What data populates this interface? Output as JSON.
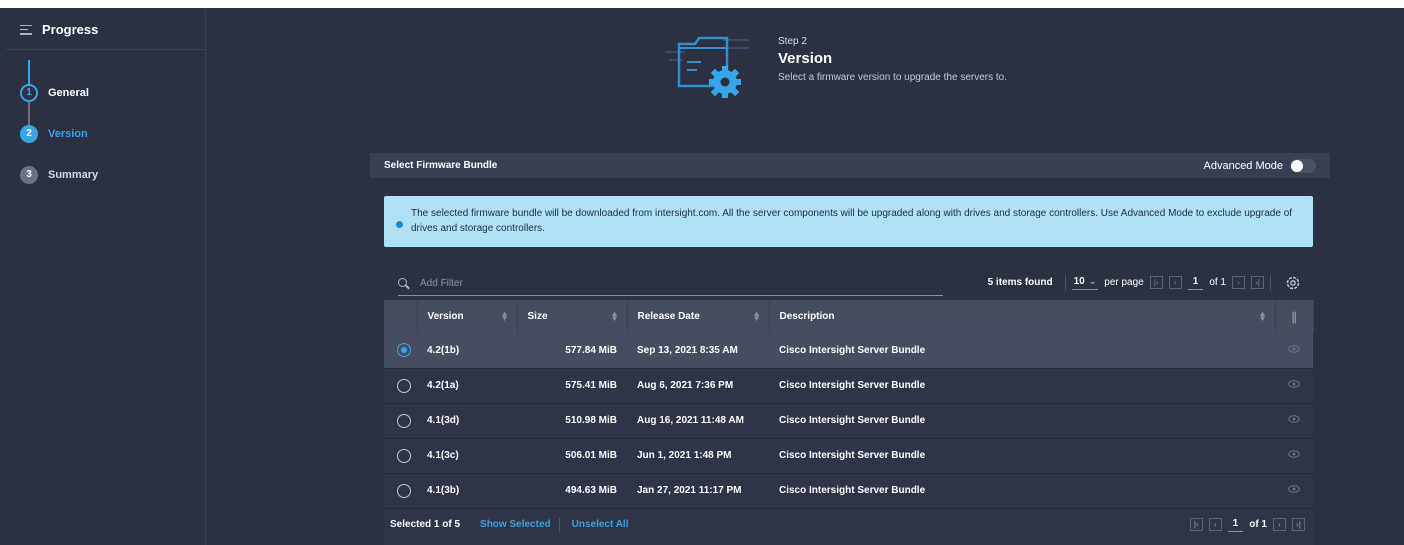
{
  "sidebar": {
    "title": "Progress",
    "steps": [
      {
        "num": "1",
        "label": "General",
        "state": "done"
      },
      {
        "num": "2",
        "label": "Version",
        "state": "active"
      },
      {
        "num": "3",
        "label": "Summary",
        "state": "todo"
      }
    ]
  },
  "header": {
    "step_label": "Step 2",
    "title": "Version",
    "subtitle": "Select a firmware version to upgrade the servers to."
  },
  "bundle": {
    "label": "Select Firmware Bundle",
    "advanced_mode_label": "Advanced Mode",
    "advanced_mode_on": false
  },
  "info": {
    "text": "The selected firmware bundle will be downloaded from intersight.com. All the server components will be upgraded along with drives and storage controllers. Use Advanced Mode to exclude upgrade of drives and storage controllers."
  },
  "table": {
    "search_placeholder": "Add Filter",
    "items_found": "5 items found",
    "per_page_value": "10",
    "per_page_label": "per page",
    "page": "1",
    "of_pages": "of 1",
    "columns": [
      "Version",
      "Size",
      "Release Date",
      "Description"
    ],
    "rows": [
      {
        "selected": true,
        "version": "4.2(1b)",
        "size": "577.84 MiB",
        "date": "Sep 13, 2021 8:35 AM",
        "description": "Cisco Intersight Server Bundle"
      },
      {
        "selected": false,
        "version": "4.2(1a)",
        "size": "575.41 MiB",
        "date": "Aug 6, 2021 7:36 PM",
        "description": "Cisco Intersight Server Bundle"
      },
      {
        "selected": false,
        "version": "4.1(3d)",
        "size": "510.98 MiB",
        "date": "Aug 16, 2021 11:48 AM",
        "description": "Cisco Intersight Server Bundle"
      },
      {
        "selected": false,
        "version": "4.1(3c)",
        "size": "506.01 MiB",
        "date": "Jun 1, 2021 1:48 PM",
        "description": "Cisco Intersight Server Bundle"
      },
      {
        "selected": false,
        "version": "4.1(3b)",
        "size": "494.63 MiB",
        "date": "Jan 27, 2021 11:17 PM",
        "description": "Cisco Intersight Server Bundle"
      }
    ],
    "footer": {
      "selected_count": "Selected 1 of 5",
      "show_selected": "Show Selected",
      "unselect_all": "Unselect All",
      "page": "1",
      "of_pages": "of 1"
    }
  },
  "colors": {
    "accent": "#37a6e8",
    "background": "#2b3140",
    "info_banner": "#b0e2f5"
  }
}
